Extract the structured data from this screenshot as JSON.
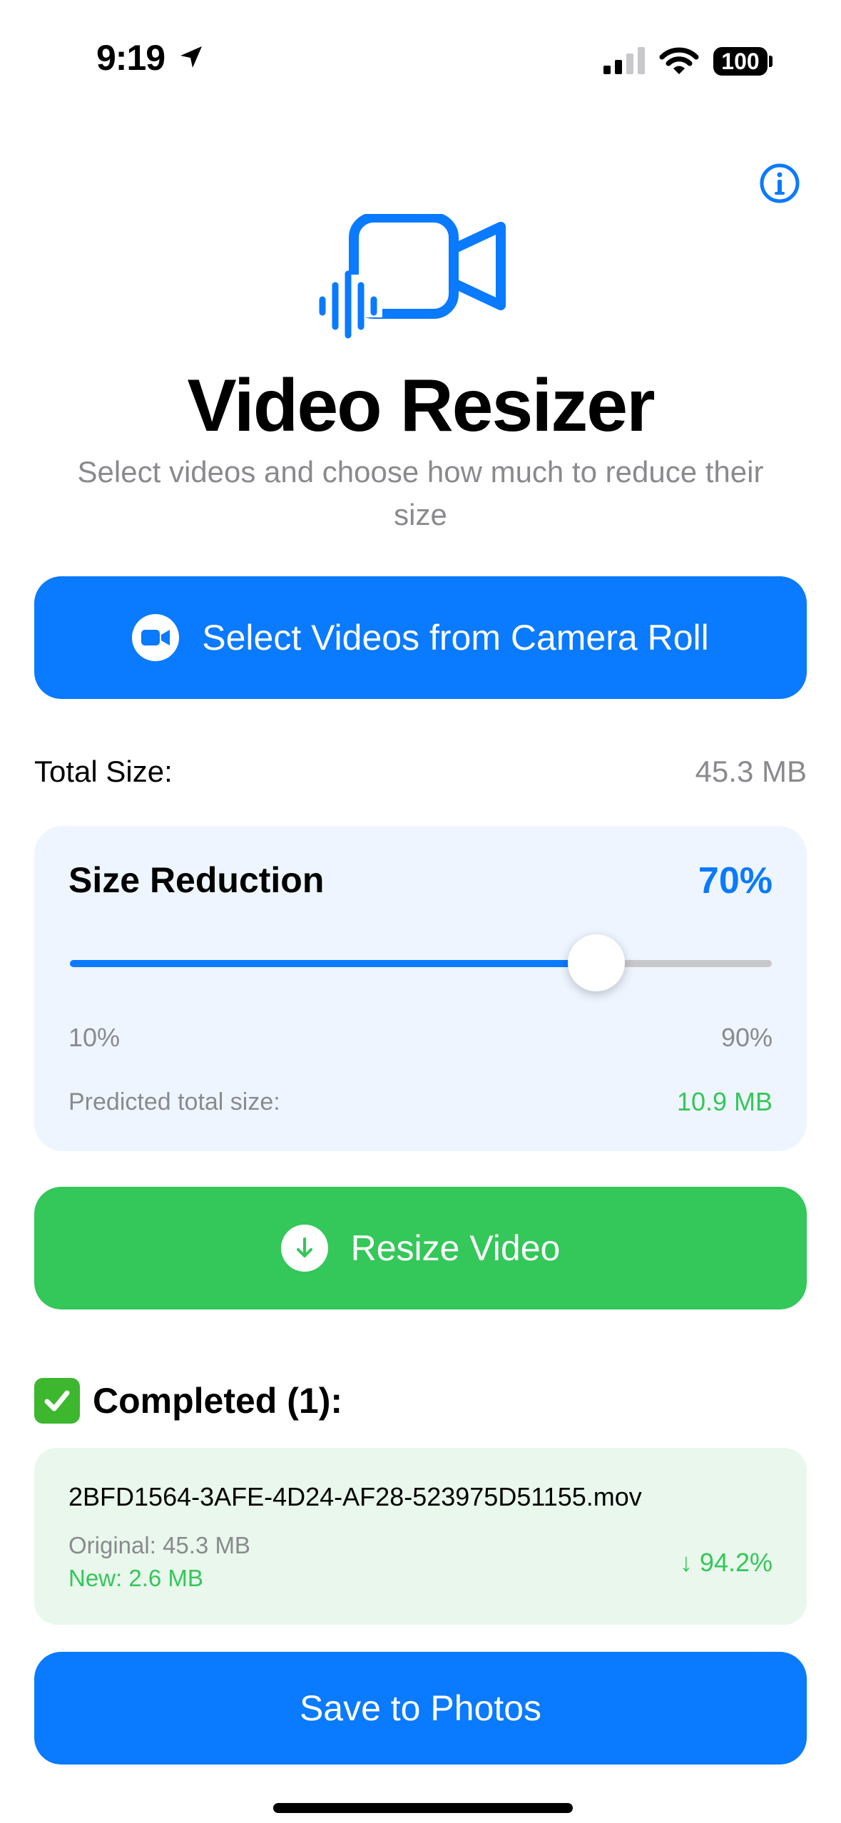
{
  "status_bar": {
    "time": "9:19",
    "battery": "100"
  },
  "header": {
    "title": "Video Resizer",
    "subtitle": "Select videos and choose how much to reduce their size"
  },
  "select_button": {
    "label": "Select Videos from Camera Roll"
  },
  "total": {
    "label": "Total Size:",
    "value": "45.3 MB"
  },
  "reduction": {
    "title": "Size Reduction",
    "percent_label": "70%",
    "slider_value_percent": 70,
    "min_label": "10%",
    "max_label": "90%",
    "predicted_label": "Predicted total size:",
    "predicted_value": "10.9 MB"
  },
  "resize_button": {
    "label": "Resize Video"
  },
  "completed": {
    "title": "Completed (1):",
    "items": [
      {
        "file_name": "2BFD1564-3AFE-4D24-AF28-523975D51155.mov",
        "original": "Original: 45.3 MB",
        "new": "New: 2.6 MB",
        "reduction": "↓ 94.2%"
      }
    ]
  },
  "save_button": {
    "label": "Save to Photos"
  },
  "colors": {
    "accent": "#0a7aff",
    "success": "#34c759",
    "secondary_text": "#8a8a8e"
  },
  "icons": [
    "location-arrow-icon",
    "cellular-signal-icon",
    "wifi-icon",
    "info-icon",
    "video-waveform-icon",
    "camera-icon",
    "download-icon",
    "checkmark-icon"
  ]
}
